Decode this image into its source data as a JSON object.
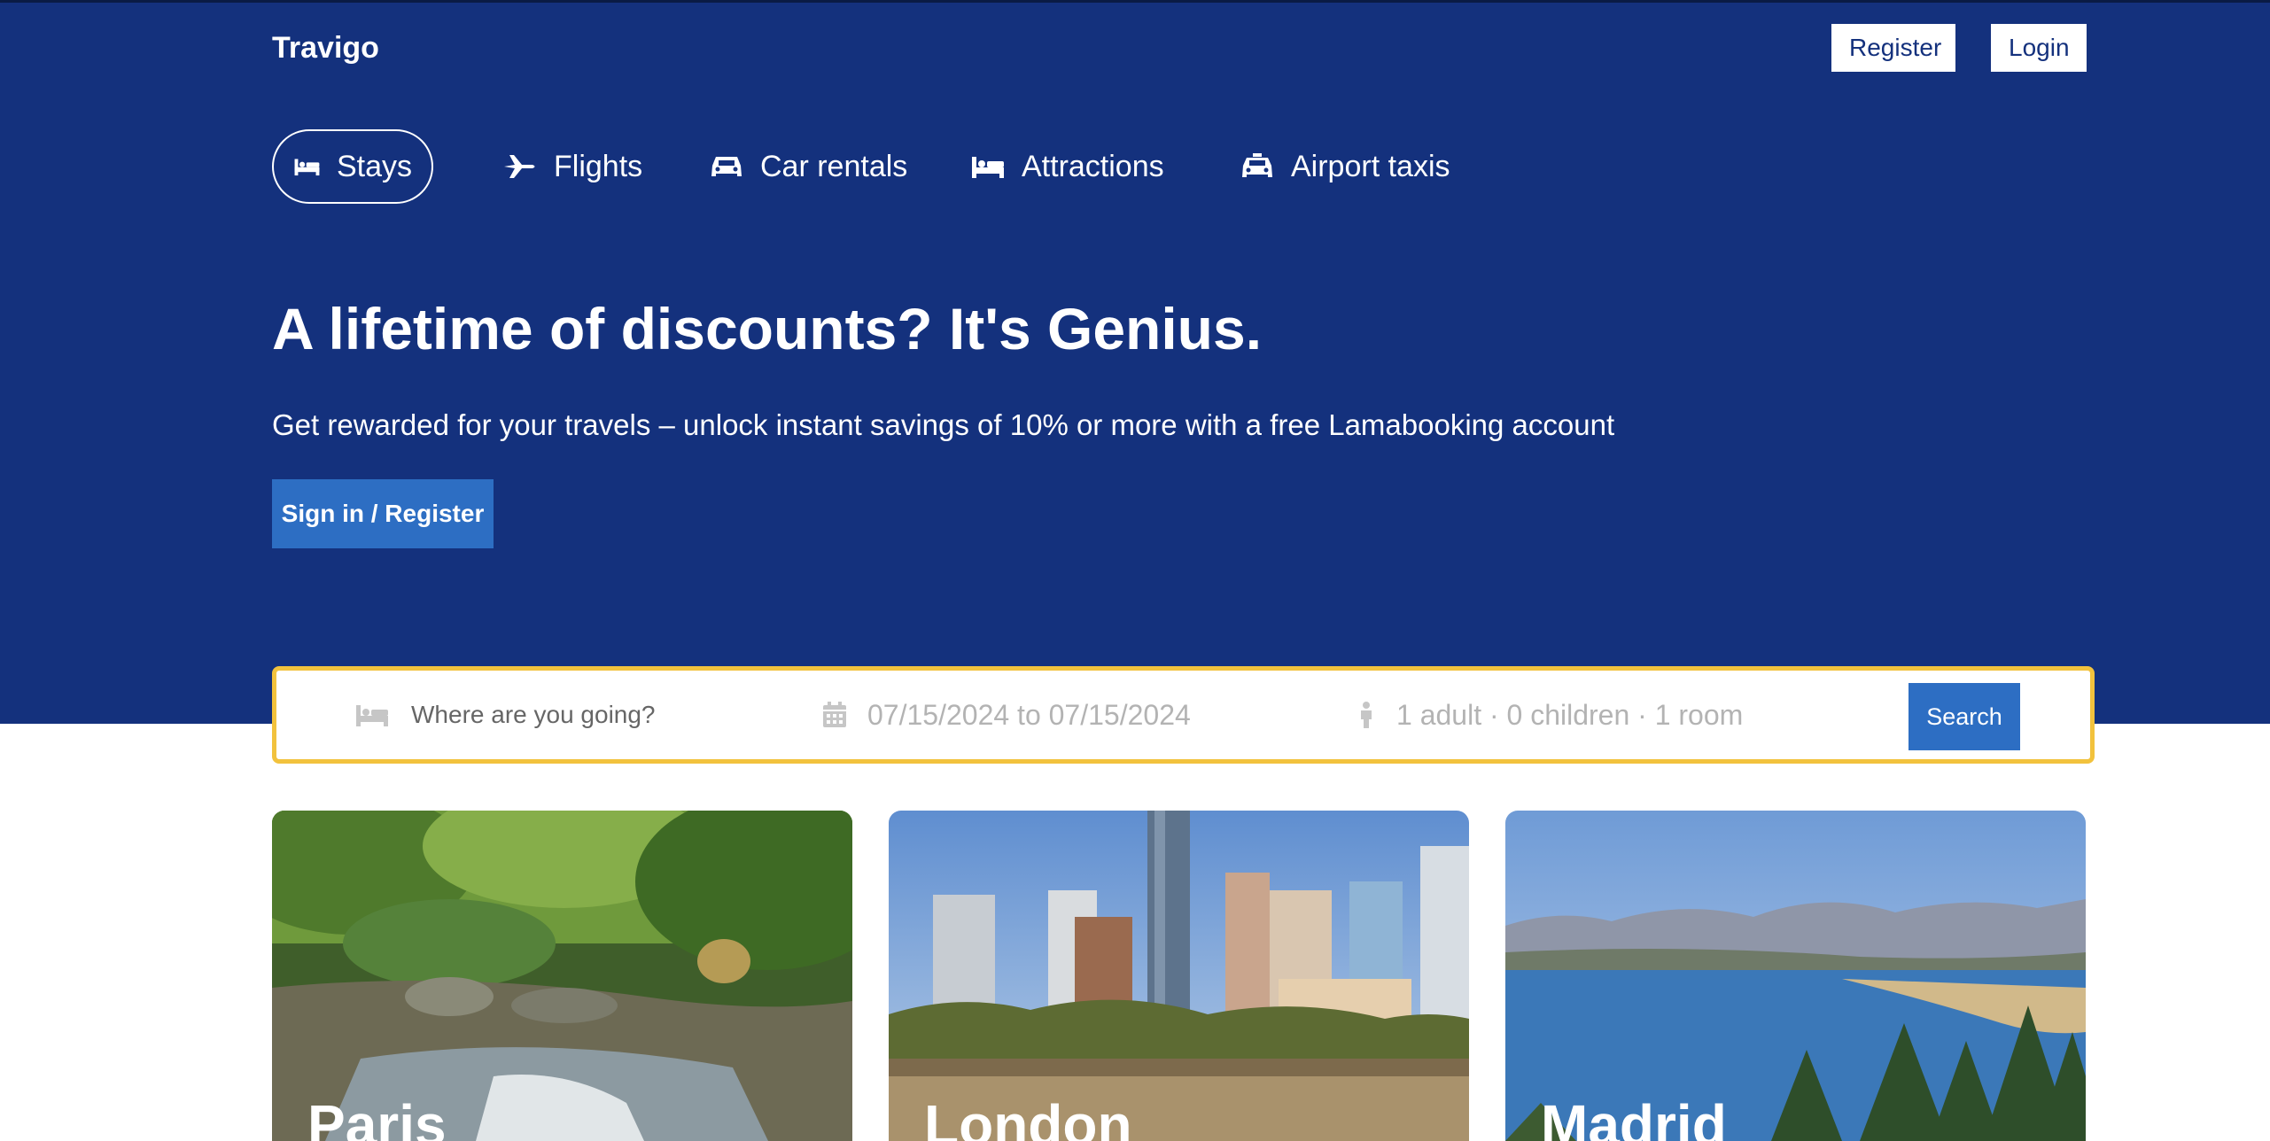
{
  "header": {
    "brand": "Travigo",
    "register_label": "Register",
    "login_label": "Login"
  },
  "nav": {
    "items": [
      {
        "label": "Stays",
        "icon": "bed-icon",
        "active": true
      },
      {
        "label": "Flights",
        "icon": "plane-icon"
      },
      {
        "label": "Car rentals",
        "icon": "car-icon"
      },
      {
        "label": "Attractions",
        "icon": "bed-icon"
      },
      {
        "label": "Airport taxis",
        "icon": "taxi-icon"
      }
    ]
  },
  "hero": {
    "title": "A lifetime of discounts? It's Genius.",
    "subtitle": "Get rewarded for your travels – unlock instant savings of 10% or more with a free Lamabooking account",
    "cta_label": "Sign in / Register"
  },
  "search": {
    "destination_placeholder": "Where are you going?",
    "dates": "07/15/2024 to 07/15/2024",
    "guests": "1 adult · 0 children · 1 room",
    "button_label": "Search"
  },
  "featured": [
    {
      "city": "Paris"
    },
    {
      "city": "London"
    },
    {
      "city": "Madrid"
    }
  ],
  "colors": {
    "brand_blue": "#14317d",
    "accent_blue": "#2d6ec3",
    "search_border": "#f2c23d"
  }
}
